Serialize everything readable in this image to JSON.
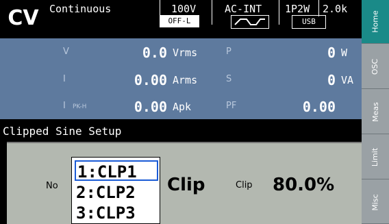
{
  "header": {
    "mode": "CV",
    "output_mode": "Continuous",
    "range": "100V",
    "source": "AC-INT",
    "wiring": "1P2W",
    "freq_range": "2.0k",
    "off_label": "OFF-L",
    "usb": "USB",
    "waveform_icon": "clipped-sine-icon"
  },
  "readings": {
    "v_label": "V",
    "v_value": "0.0",
    "v_unit": "Vrms",
    "i_label": "I",
    "i_value": "0.00",
    "i_unit": "Arms",
    "ipk_label": "I",
    "ipk_sub": "PK-H",
    "ipk_value": "0.00",
    "ipk_unit": "Apk",
    "p_label": "P",
    "p_value": "0",
    "p_unit": "W",
    "s_label": "S",
    "s_value": "0",
    "s_unit": "VA",
    "pf_label": "PF",
    "pf_value": "0.00"
  },
  "section_title": "Clipped Sine Setup",
  "setup": {
    "no_label": "No",
    "options": [
      "1:CLP1",
      "2:CLP2",
      "3:CLP3"
    ],
    "selected_index": 0,
    "type_value": "Clip",
    "clip_label": "Clip",
    "clip_value": "80.0%"
  },
  "tabs": [
    "Home",
    "OSC",
    "Meas",
    "Limit",
    "Misc"
  ],
  "colors": {
    "panel": "#5e7a9e",
    "setup_bg": "#b3b8b0",
    "tab_active": "#1a8a88",
    "tab_bg": "#9aa1a5",
    "dropdown_focus": "#1a5bd6"
  }
}
